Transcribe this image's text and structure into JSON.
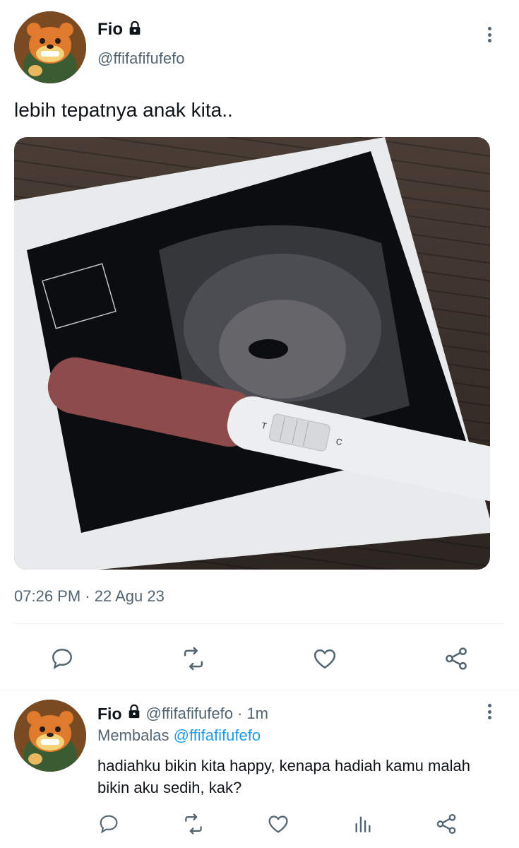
{
  "tweet": {
    "name": "Fio",
    "handle": "@ffifafifufefo",
    "text": "lebih tepatnya anak kita..",
    "timestamp": "07:26 PM · 22 Agu 23"
  },
  "reply": {
    "name": "Fio",
    "handle": "@ffifafifufefo",
    "time": "· 1m",
    "replying_prefix": "Membalas",
    "replying_to": "@ffifafifufefo",
    "text": "hadiahku bikin kita happy, kenapa hadiah kamu malah bikin aku sedih, kak?"
  },
  "icons": {
    "lock": "lock-icon",
    "more": "more-vertical-icon",
    "reply": "reply-icon",
    "retweet": "retweet-icon",
    "like": "heart-icon",
    "share": "share-icon",
    "analytics": "analytics-icon"
  },
  "colors": {
    "text": "#0f1419",
    "muted": "#536471",
    "link": "#1d9bf0",
    "divider": "#eff3f4"
  }
}
